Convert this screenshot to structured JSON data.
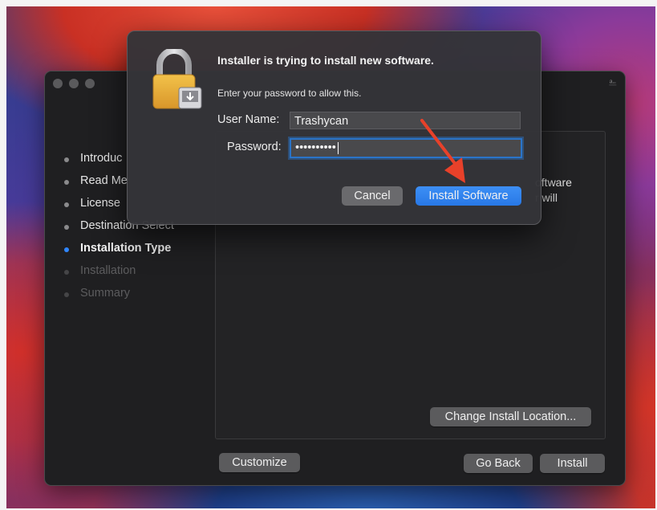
{
  "installer": {
    "steps": [
      {
        "label": "Introduc",
        "state": "done"
      },
      {
        "label": "Read Me",
        "state": "done"
      },
      {
        "label": "License",
        "state": "done"
      },
      {
        "label": "Destination Select",
        "state": "done"
      },
      {
        "label": "Installation Type",
        "state": "active"
      },
      {
        "label": "Installation",
        "state": "pending"
      },
      {
        "label": "Summary",
        "state": "pending"
      }
    ],
    "pane_text": {
      "line1": "oftware",
      "line2": "r will"
    },
    "buttons": {
      "change_location": "Change Install Location...",
      "customize": "Customize",
      "go_back": "Go Back",
      "install": "Install"
    }
  },
  "auth_dialog": {
    "title": "Installer is trying to install new software.",
    "message": "Enter your password to allow this.",
    "username_label": "User Name:",
    "username_value": "Trashycan",
    "password_label": "Password:",
    "password_mask": "••••••••••",
    "cancel_label": "Cancel",
    "install_label": "Install Software"
  },
  "colors": {
    "accent": "#2f86ff",
    "arrow": "#e8412a"
  },
  "icons": {
    "dialog": "lock-icon",
    "titlebar": "lock-icon"
  }
}
